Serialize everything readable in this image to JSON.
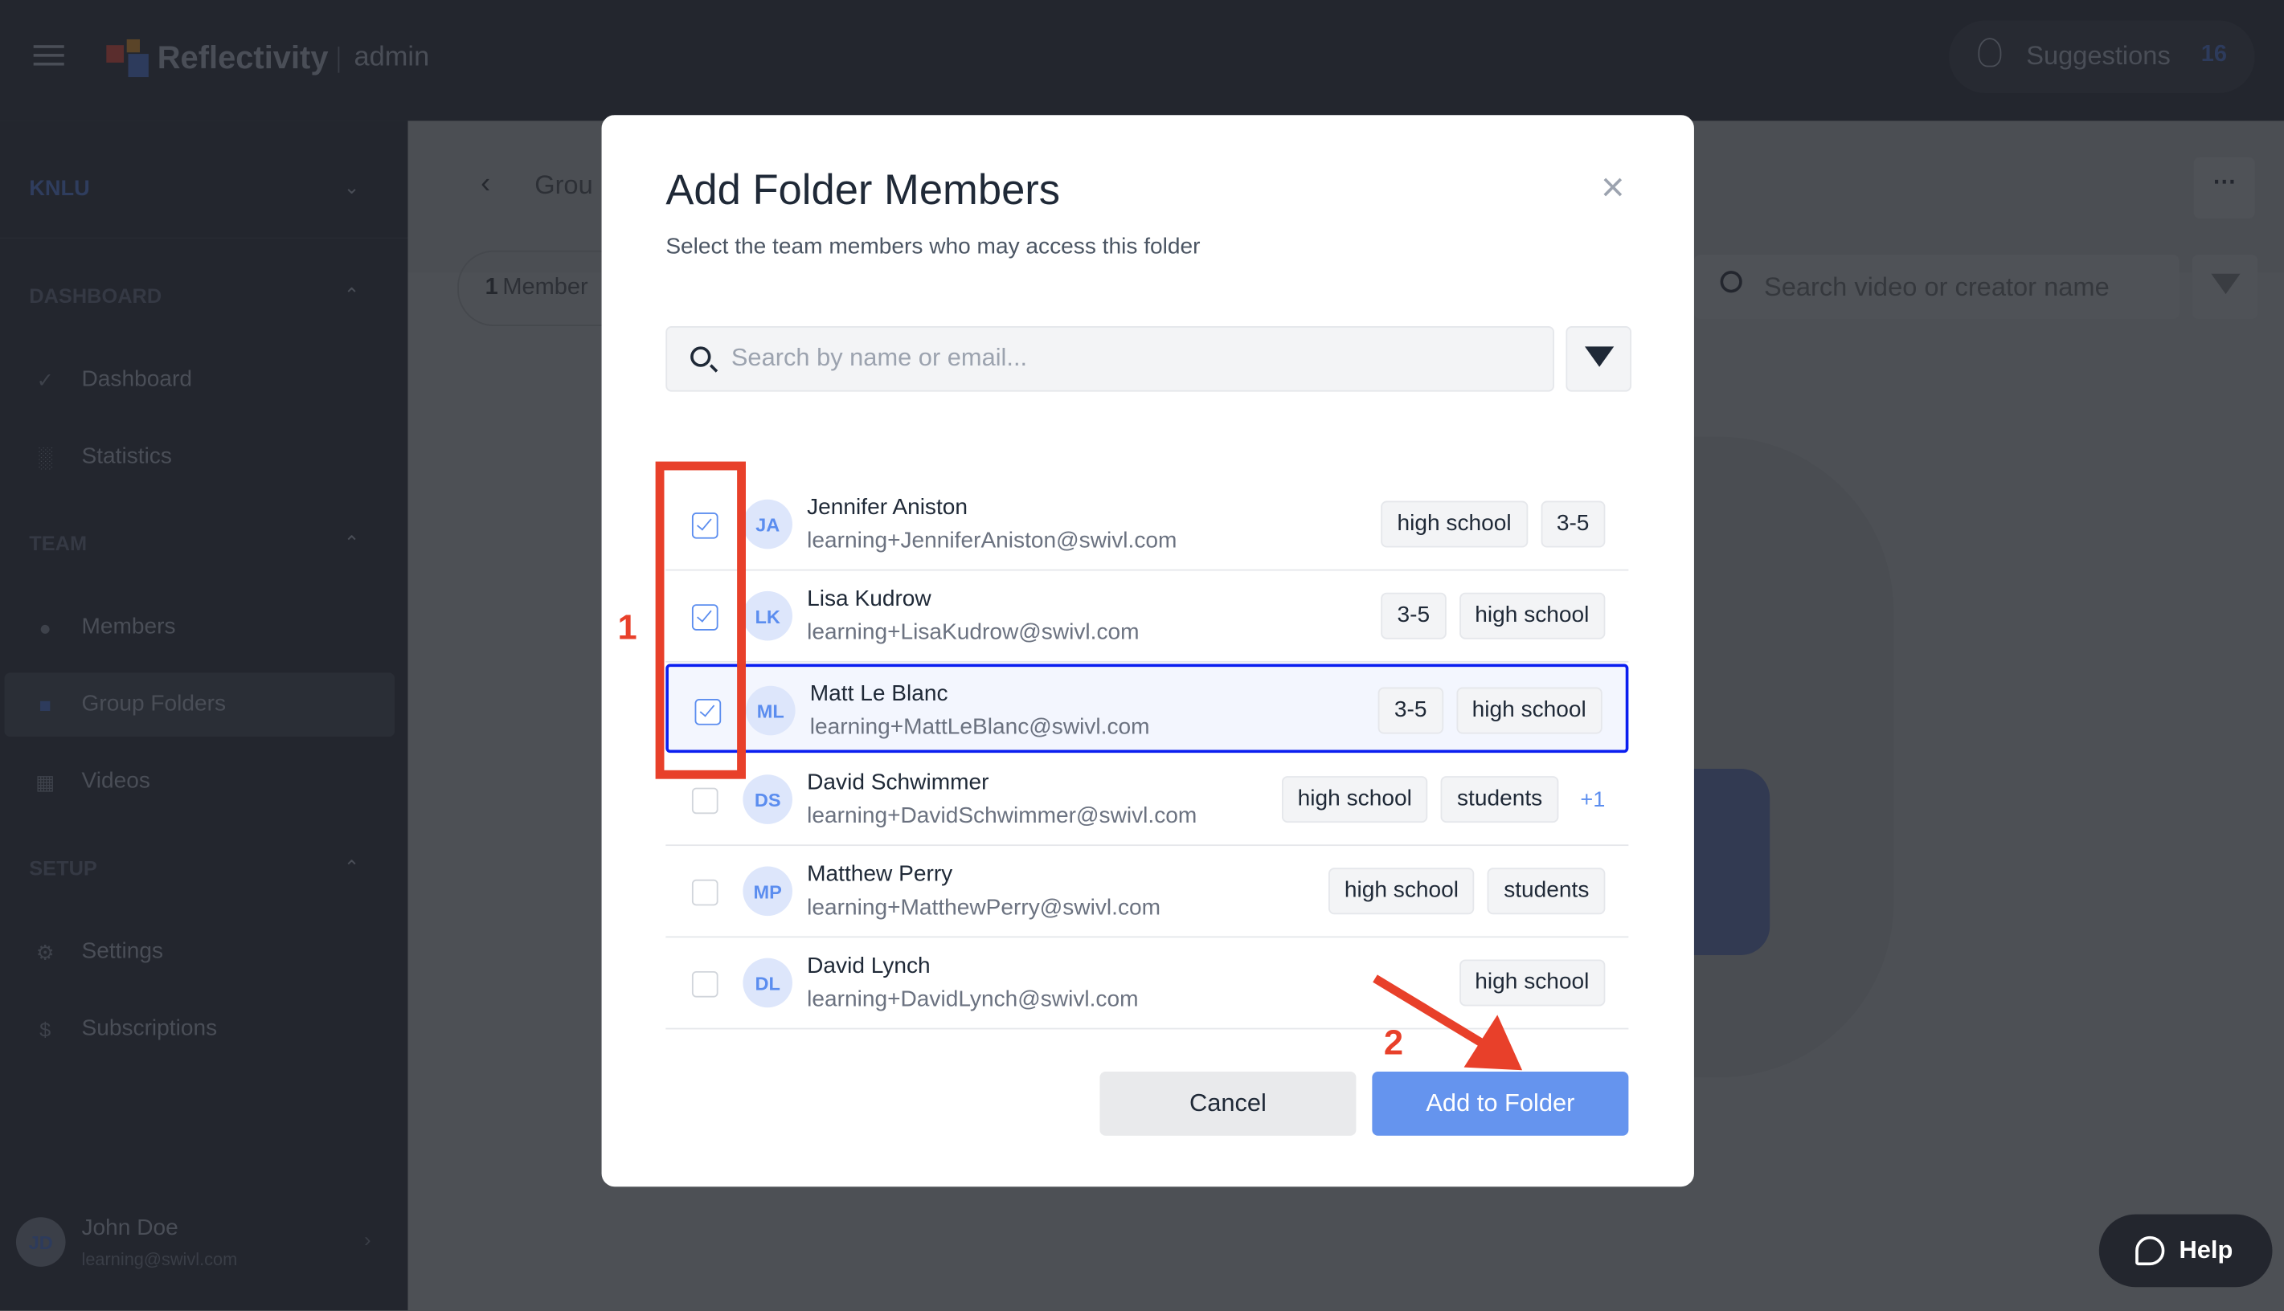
{
  "app": {
    "brand": "Reflectivity",
    "role": "admin",
    "suggestions_label": "Suggestions",
    "suggestions_count": "16"
  },
  "sidebar": {
    "org": "KNLU",
    "sections": [
      {
        "label": "DASHBOARD"
      },
      {
        "label": "TEAM"
      },
      {
        "label": "SETUP"
      }
    ],
    "items": [
      {
        "label": "Dashboard"
      },
      {
        "label": "Statistics"
      },
      {
        "label": "Members"
      },
      {
        "label": "Group Folders"
      },
      {
        "label": "Videos"
      },
      {
        "label": "Settings"
      },
      {
        "label": "Subscriptions"
      }
    ],
    "user": {
      "initials": "JD",
      "name": "John Doe",
      "email": "learning@swivl.com"
    }
  },
  "main": {
    "breadcrumb": "Grou",
    "member_count": "1",
    "member_label": "Member",
    "search_placeholder": "Search video or creator name",
    "help_label": "Help"
  },
  "modal": {
    "title": "Add Folder Members",
    "subtitle": "Select the team members who may access this folder",
    "search_placeholder": "Search by name or email...",
    "members": [
      {
        "initials": "JA",
        "name": "Jennifer Aniston",
        "email": "learning+JenniferAniston@swivl.com",
        "tags": [
          "high school",
          "3-5"
        ],
        "more": "",
        "checked": true
      },
      {
        "initials": "LK",
        "name": "Lisa Kudrow",
        "email": "learning+LisaKudrow@swivl.com",
        "tags": [
          "3-5",
          "high school"
        ],
        "more": "",
        "checked": true
      },
      {
        "initials": "ML",
        "name": "Matt Le Blanc",
        "email": "learning+MattLeBlanc@swivl.com",
        "tags": [
          "3-5",
          "high school"
        ],
        "more": "",
        "checked": true
      },
      {
        "initials": "DS",
        "name": "David Schwimmer",
        "email": "learning+DavidSchwimmer@swivl.com",
        "tags": [
          "high school",
          "students"
        ],
        "more": "+1",
        "checked": false
      },
      {
        "initials": "MP",
        "name": "Matthew Perry",
        "email": "learning+MatthewPerry@swivl.com",
        "tags": [
          "high school",
          "students"
        ],
        "more": "",
        "checked": false
      },
      {
        "initials": "DL",
        "name": "David Lynch",
        "email": "learning+DavidLynch@swivl.com",
        "tags": [
          "high school"
        ],
        "more": "",
        "checked": false
      }
    ],
    "cancel_label": "Cancel",
    "submit_label": "Add to Folder"
  },
  "annotations": {
    "step1": "1",
    "step2": "2",
    "color": "#e8402a"
  },
  "colors": {
    "accent": "#6594ee",
    "selected_border": "#0a1ef0"
  }
}
